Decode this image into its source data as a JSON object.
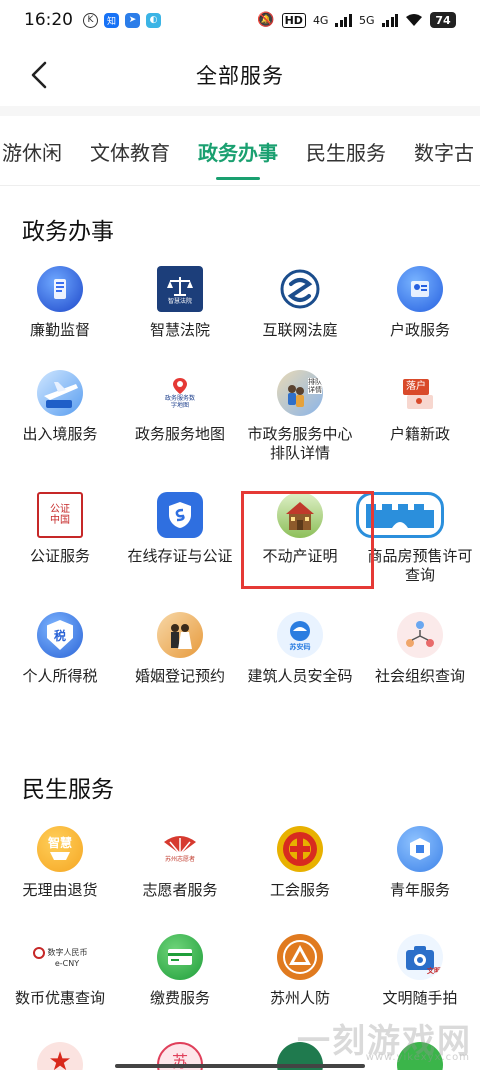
{
  "status_bar": {
    "time": "16:20",
    "hd_label": "HD",
    "net_4g": "4G",
    "net_5g": "5G",
    "battery": "74"
  },
  "header": {
    "title": "全部服务"
  },
  "tabs": [
    {
      "label": "游休闲",
      "active": false
    },
    {
      "label": "文体教育",
      "active": false
    },
    {
      "label": "政务办事",
      "active": true
    },
    {
      "label": "民生服务",
      "active": false
    },
    {
      "label": "数字古",
      "active": false
    }
  ],
  "sections": [
    {
      "title": "政务办事",
      "items": [
        {
          "label": "廉勤监督",
          "icon": "disciplinary-supervision-icon"
        },
        {
          "label": "智慧法院",
          "icon": "smart-court-icon"
        },
        {
          "label": "互联网法庭",
          "icon": "internet-court-icon"
        },
        {
          "label": "户政服务",
          "icon": "household-service-icon"
        },
        {
          "label": "出入境服务",
          "icon": "exit-entry-icon"
        },
        {
          "label": "政务服务地图",
          "icon": "service-map-icon"
        },
        {
          "label": "市政务服务中心排队详情",
          "icon": "queue-details-icon"
        },
        {
          "label": "户籍新政",
          "icon": "household-policy-icon"
        },
        {
          "label": "公证服务",
          "icon": "notary-service-icon"
        },
        {
          "label": "在线存证与公证",
          "icon": "online-evidence-icon"
        },
        {
          "label": "不动产证明",
          "icon": "real-estate-house-icon"
        },
        {
          "label": "商品房预售许可查询",
          "icon": "presale-permit-icon"
        },
        {
          "label": "个人所得税",
          "icon": "income-tax-icon"
        },
        {
          "label": "婚姻登记预约",
          "icon": "marriage-registration-icon"
        },
        {
          "label": "建筑人员安全码",
          "icon": "construction-safety-code-icon"
        },
        {
          "label": "社会组织查询",
          "icon": "social-organization-icon"
        }
      ]
    },
    {
      "title": "民生服务",
      "items": [
        {
          "label": "无理由退货",
          "icon": "return-goods-icon"
        },
        {
          "label": "志愿者服务",
          "icon": "volunteer-service-icon"
        },
        {
          "label": "工会服务",
          "icon": "trade-union-icon"
        },
        {
          "label": "青年服务",
          "icon": "youth-service-icon"
        },
        {
          "label": "数币优惠查询",
          "icon": "digital-currency-icon"
        },
        {
          "label": "缴费服务",
          "icon": "payment-service-icon"
        },
        {
          "label": "苏州人防",
          "icon": "civil-defense-icon"
        },
        {
          "label": "文明随手拍",
          "icon": "civilization-photo-icon"
        }
      ]
    }
  ],
  "icon_texts": {
    "smart_court": "智慧法院",
    "service_map": "政务服务数字地图",
    "queue": "排队详情",
    "household_policy": "落户",
    "notary": "公证中国",
    "tax": "税",
    "safety_code": "苏安码",
    "return_goods": "智慧",
    "volunteer": "苏州志愿者",
    "digital_currency_cn": "数字人民币",
    "digital_currency_en": "e-CNY",
    "civilization": "文明",
    "volunteer_badge": "苏"
  },
  "watermark": {
    "text": "一刻游戏网",
    "sub": "www.yikexyx.com"
  },
  "highlight_target": "不动产证明",
  "colors": {
    "accent": "#1aa070",
    "highlight": "#e53935"
  }
}
